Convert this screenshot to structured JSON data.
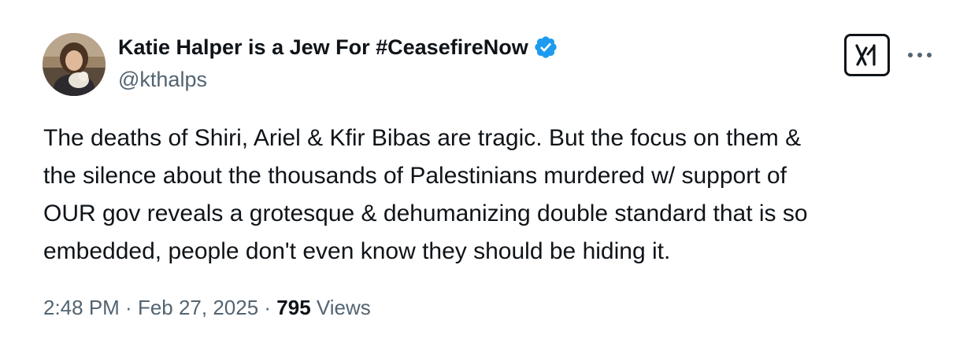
{
  "author": {
    "name": "Katie Halper is a Jew For #CeasefireNow",
    "handle": "@kthalps",
    "verified": true,
    "avatar": "avatar"
  },
  "icons": {
    "verified": "verified-badge-icon",
    "grok": "grok-icon",
    "more": "more-icon"
  },
  "tweet": {
    "text": "The deaths of Shiri, Ariel & Kfir Bibas are tragic. But the focus on them &\nthe silence about the thousands of Palestinians murdered w/ support of\nOUR gov reveals a grotesque & dehumanizing double standard that is so\nembedded, people don't even know they should be hiding it.",
    "time": "2:48 PM",
    "separator": " · ",
    "date": "Feb 27, 2025",
    "views_count": "795",
    "views_label": " Views"
  },
  "colors": {
    "text": "#0f1419",
    "secondary": "#536471",
    "verified": "#1d9bf0"
  }
}
